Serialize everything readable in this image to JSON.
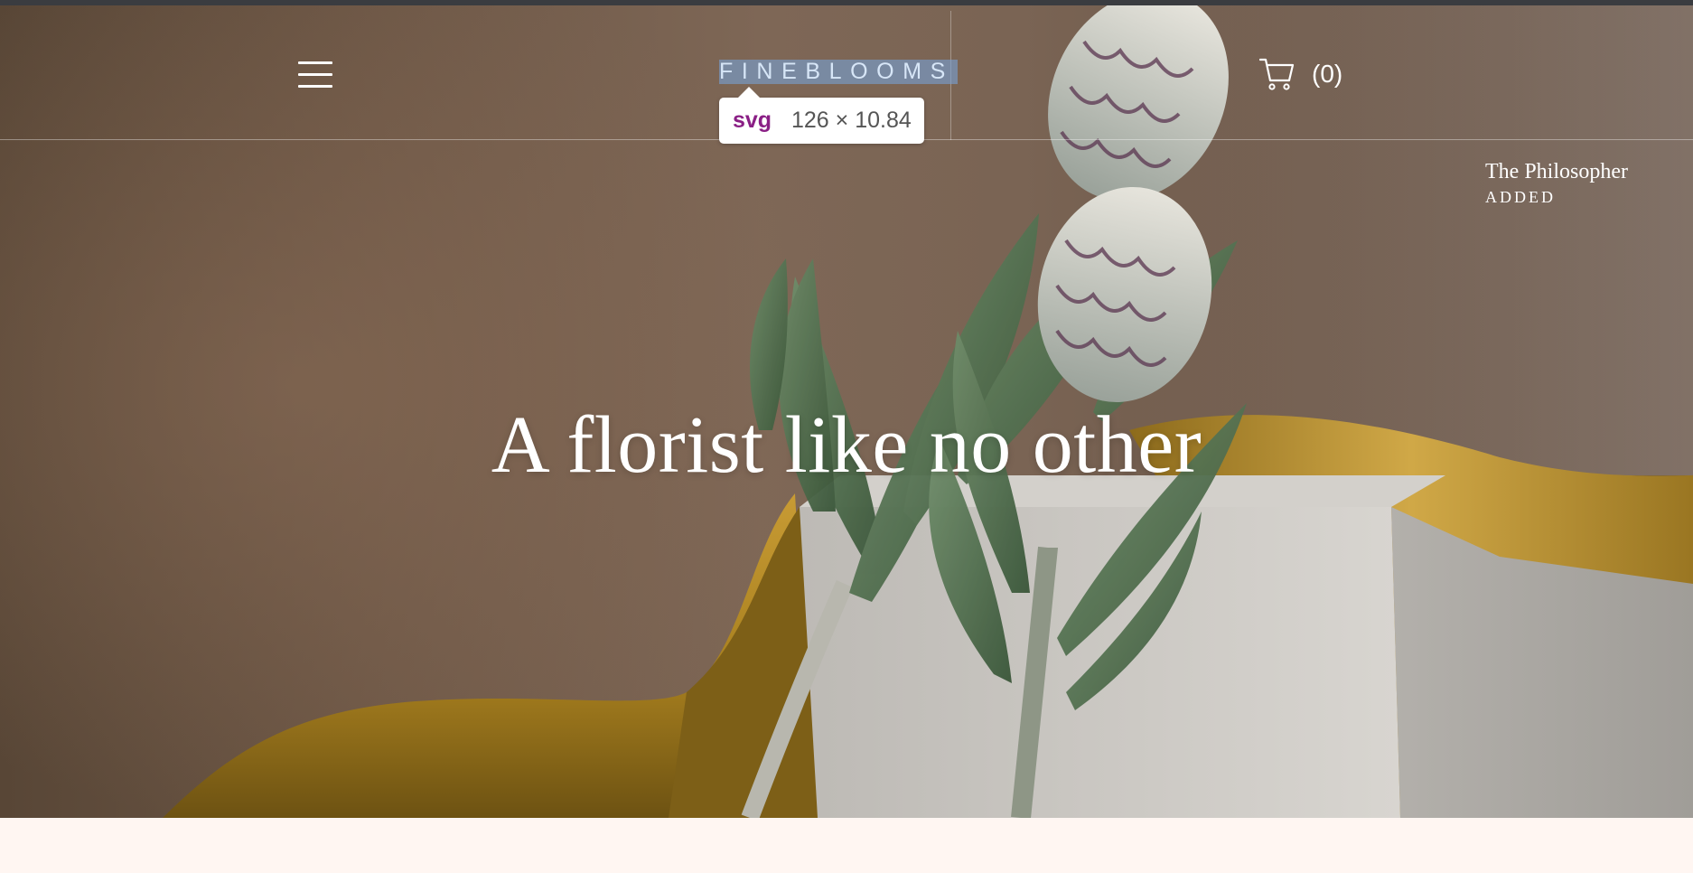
{
  "header": {
    "logo_text": "FINEBLOOMS",
    "cart_count": "(0)",
    "menu_icon": "hamburger-menu-icon",
    "cart_icon": "shopping-cart-icon"
  },
  "inspector_tooltip": {
    "tag": "svg",
    "dimensions": "126 × 10.84"
  },
  "cart_notice": {
    "product": "The Philosopher",
    "status": "ADDED"
  },
  "hero": {
    "title": "A florist like no other"
  },
  "colors": {
    "background_brown": "#6f5a49",
    "silk_gold": "#b8902c",
    "stone_grey": "#c9c6c1",
    "leaf_green": "#4b6b4a",
    "page_cream": "#fff6f2",
    "tooltip_tag": "#8a1f85",
    "logo_highlight": "#7aa0d2"
  }
}
